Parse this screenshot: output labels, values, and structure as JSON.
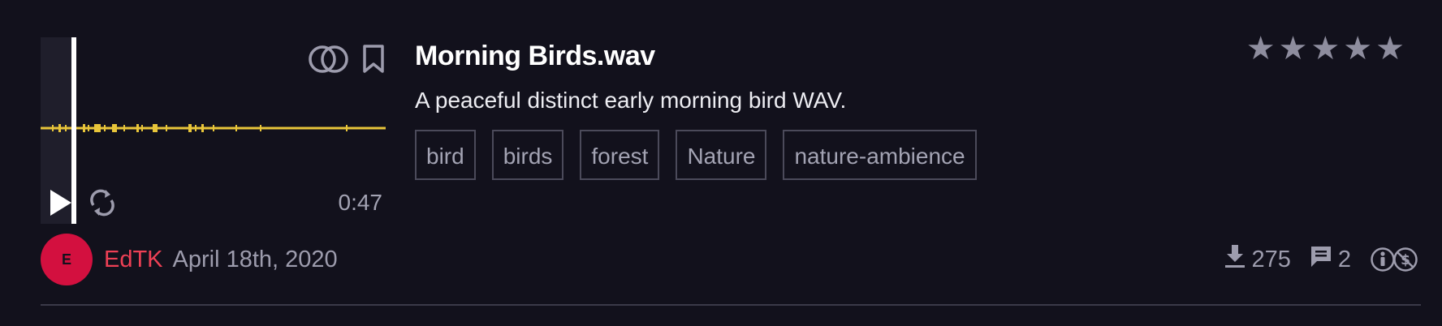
{
  "sound": {
    "title": "Morning Birds.wav",
    "description": "A peaceful distinct early morning bird WAV.",
    "duration": "0:47",
    "tags": [
      "bird",
      "birds",
      "forest",
      "Nature",
      "nature-ambience"
    ],
    "rating_stars": 5,
    "playback_progress": 0.09
  },
  "author": {
    "initial": "E",
    "name": "EdTK",
    "date": "April 18th, 2020"
  },
  "stats": {
    "downloads": "275",
    "comments": "2"
  },
  "icons": {
    "compare": "overlapping-circles-icon",
    "bookmark": "bookmark-icon",
    "play": "play-icon",
    "loop": "loop-icon",
    "download": "download-icon",
    "comment": "comment-icon",
    "license": "cc-by-nc-icon",
    "star": "star-icon"
  },
  "colors": {
    "background": "#12111c",
    "waveform": "#e8c53a",
    "accent": "#ee4055",
    "avatar": "#d3103f"
  }
}
